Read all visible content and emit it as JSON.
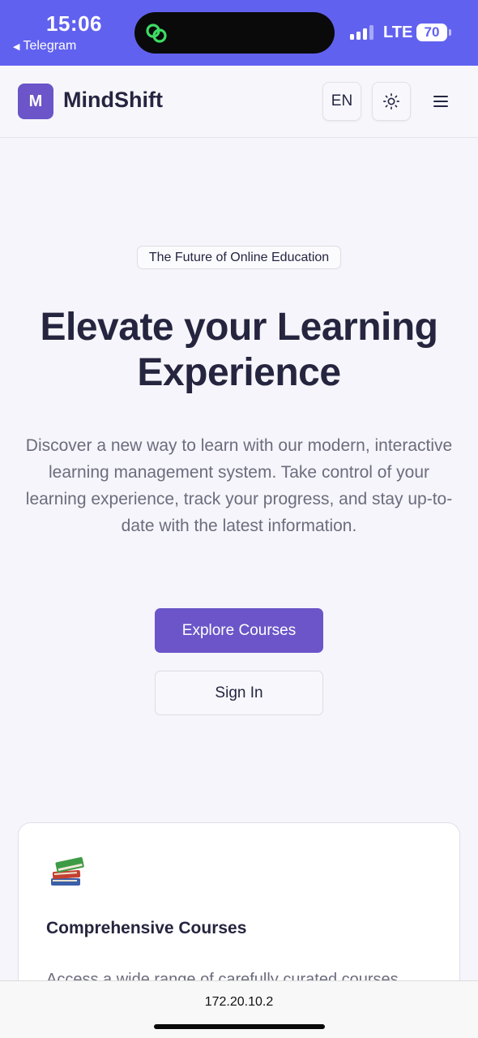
{
  "status_bar": {
    "time": "15:06",
    "back_label": "Telegram",
    "network": "LTE",
    "battery": "70"
  },
  "header": {
    "logo_letter": "M",
    "brand": "MindShift",
    "language": "EN"
  },
  "hero": {
    "badge": "The Future of Online Education",
    "title_line1": "Elevate your Learning",
    "title_line2": "Experience",
    "description": "Discover a new way to learn with our modern, interactive learning management system. Take control of your learning experience, track your progress, and stay up-to-date with the latest information.",
    "primary_button": "Explore Courses",
    "secondary_button": "Sign In"
  },
  "feature": {
    "icon": "books-icon",
    "title": "Comprehensive Courses",
    "description": "Access a wide range of carefully curated courses"
  },
  "browser": {
    "url": "172.20.10.2"
  },
  "colors": {
    "status_bar": "#6161f0",
    "accent": "#6b55c8",
    "title": "#25253f",
    "muted_text": "#6c6c7e"
  }
}
